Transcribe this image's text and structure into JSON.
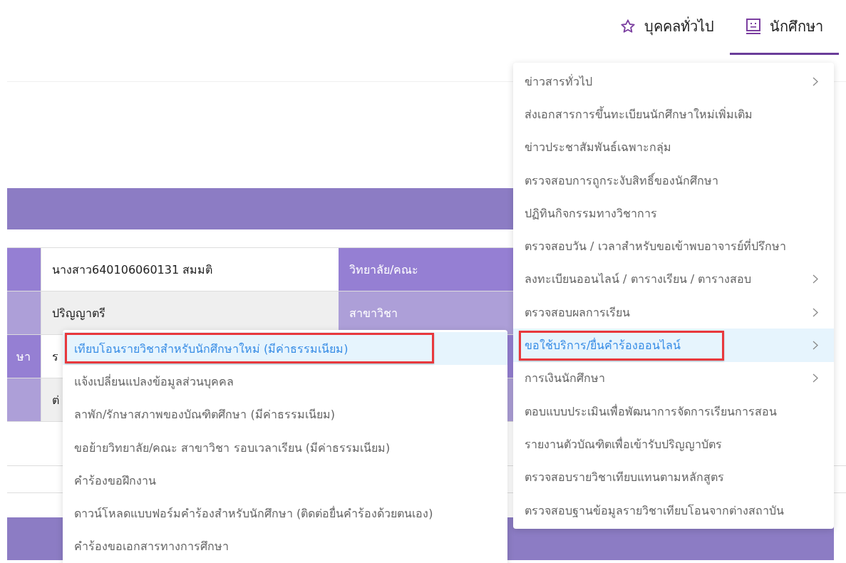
{
  "tabs": [
    {
      "label": "บุคคลทั่วไป",
      "selected": false
    },
    {
      "label": "นักศึกษา",
      "selected": true
    }
  ],
  "info_table": {
    "rows": [
      {
        "value": "นางสาว640106060131 สมมติ",
        "label_2": "วิทยาลัย/คณะ"
      },
      {
        "value": "ปริญญาตรี",
        "label_2": "สาขาวิชา"
      },
      {
        "label": "ษา",
        "value": "ร"
      },
      {
        "value": "ต่"
      }
    ]
  },
  "menu": {
    "items": [
      {
        "label": "ข่าวสารทั่วไป",
        "has_submenu": true,
        "selected": false,
        "annotated": false
      },
      {
        "label": "ส่งเอกสารการขึ้นทะเบียนนักศึกษาใหม่เพิ่มเติม",
        "has_submenu": false,
        "selected": false,
        "annotated": false
      },
      {
        "label": "ข่าวประชาสัมพันธ์เฉพาะกลุ่ม",
        "has_submenu": false,
        "selected": false,
        "annotated": false
      },
      {
        "label": "ตรวจสอบการถูกระงับสิทธิ์ของนักศึกษา",
        "has_submenu": false,
        "selected": false,
        "annotated": false
      },
      {
        "label": "ปฏิทินกิจกรรมทางวิชาการ",
        "has_submenu": false,
        "selected": false,
        "annotated": false
      },
      {
        "label": "ตรวจสอบวัน / เวลาสำหรับขอเข้าพบอาจารย์ที่ปรึกษา",
        "has_submenu": false,
        "selected": false,
        "annotated": false
      },
      {
        "label": "ลงทะเบียนออนไลน์ / ตารางเรียน / ตารางสอบ",
        "has_submenu": true,
        "selected": false,
        "annotated": false
      },
      {
        "label": "ตรวจสอบผลการเรียน",
        "has_submenu": true,
        "selected": false,
        "annotated": false
      },
      {
        "label": "ขอใช้บริการ/ยื่นคำร้องออนไลน์",
        "has_submenu": true,
        "selected": true,
        "annotated": true
      },
      {
        "label": "การเงินนักศึกษา",
        "has_submenu": true,
        "selected": false,
        "annotated": false
      },
      {
        "label": "ตอบแบบประเมินเพื่อพัฒนาการจัดการเรียนการสอน",
        "has_submenu": false,
        "selected": false,
        "annotated": false
      },
      {
        "label": "รายงานตัวบัณฑิตเพื่อเข้ารับปริญญาบัตร",
        "has_submenu": false,
        "selected": false,
        "annotated": false
      },
      {
        "label": "ตรวจสอบรายวิชาเทียบแทนตามหลักสูตร",
        "has_submenu": false,
        "selected": false,
        "annotated": false
      },
      {
        "label": "ตรวจสอบฐานข้อมูลรายวิชาเทียบโอนจากต่างสถาบัน",
        "has_submenu": false,
        "selected": false,
        "annotated": false
      }
    ]
  },
  "submenu": {
    "items": [
      {
        "label": "เทียบโอนรายวิชาสำหรับนักศึกษาใหม่ (มีค่าธรรมเนียม)",
        "selected": true,
        "annotated": true
      },
      {
        "label": "แจ้งเปลี่ยนแปลงข้อมูลส่วนบุคคล",
        "selected": false,
        "annotated": false
      },
      {
        "label": "ลาพัก/รักษาสภาพของบัณฑิตศึกษา (มีค่าธรรมเนียม)",
        "selected": false,
        "annotated": false
      },
      {
        "label": "ขอย้ายวิทยาลัย/คณะ สาขาวิชา รอบเวลาเรียน (มีค่าธรรมเนียม)",
        "selected": false,
        "annotated": false
      },
      {
        "label": "คำร้องขอฝึกงาน",
        "selected": false,
        "annotated": false
      },
      {
        "label": "ดาวน์โหลดแบบฟอร์มคำร้องสำหรับนักศึกษา (ติดต่อยื่นคำร้องด้วยตนเอง)",
        "selected": false,
        "annotated": false
      },
      {
        "label": "คำร้องขอเอกสารทางการศึกษา",
        "selected": false,
        "annotated": false
      }
    ]
  }
}
